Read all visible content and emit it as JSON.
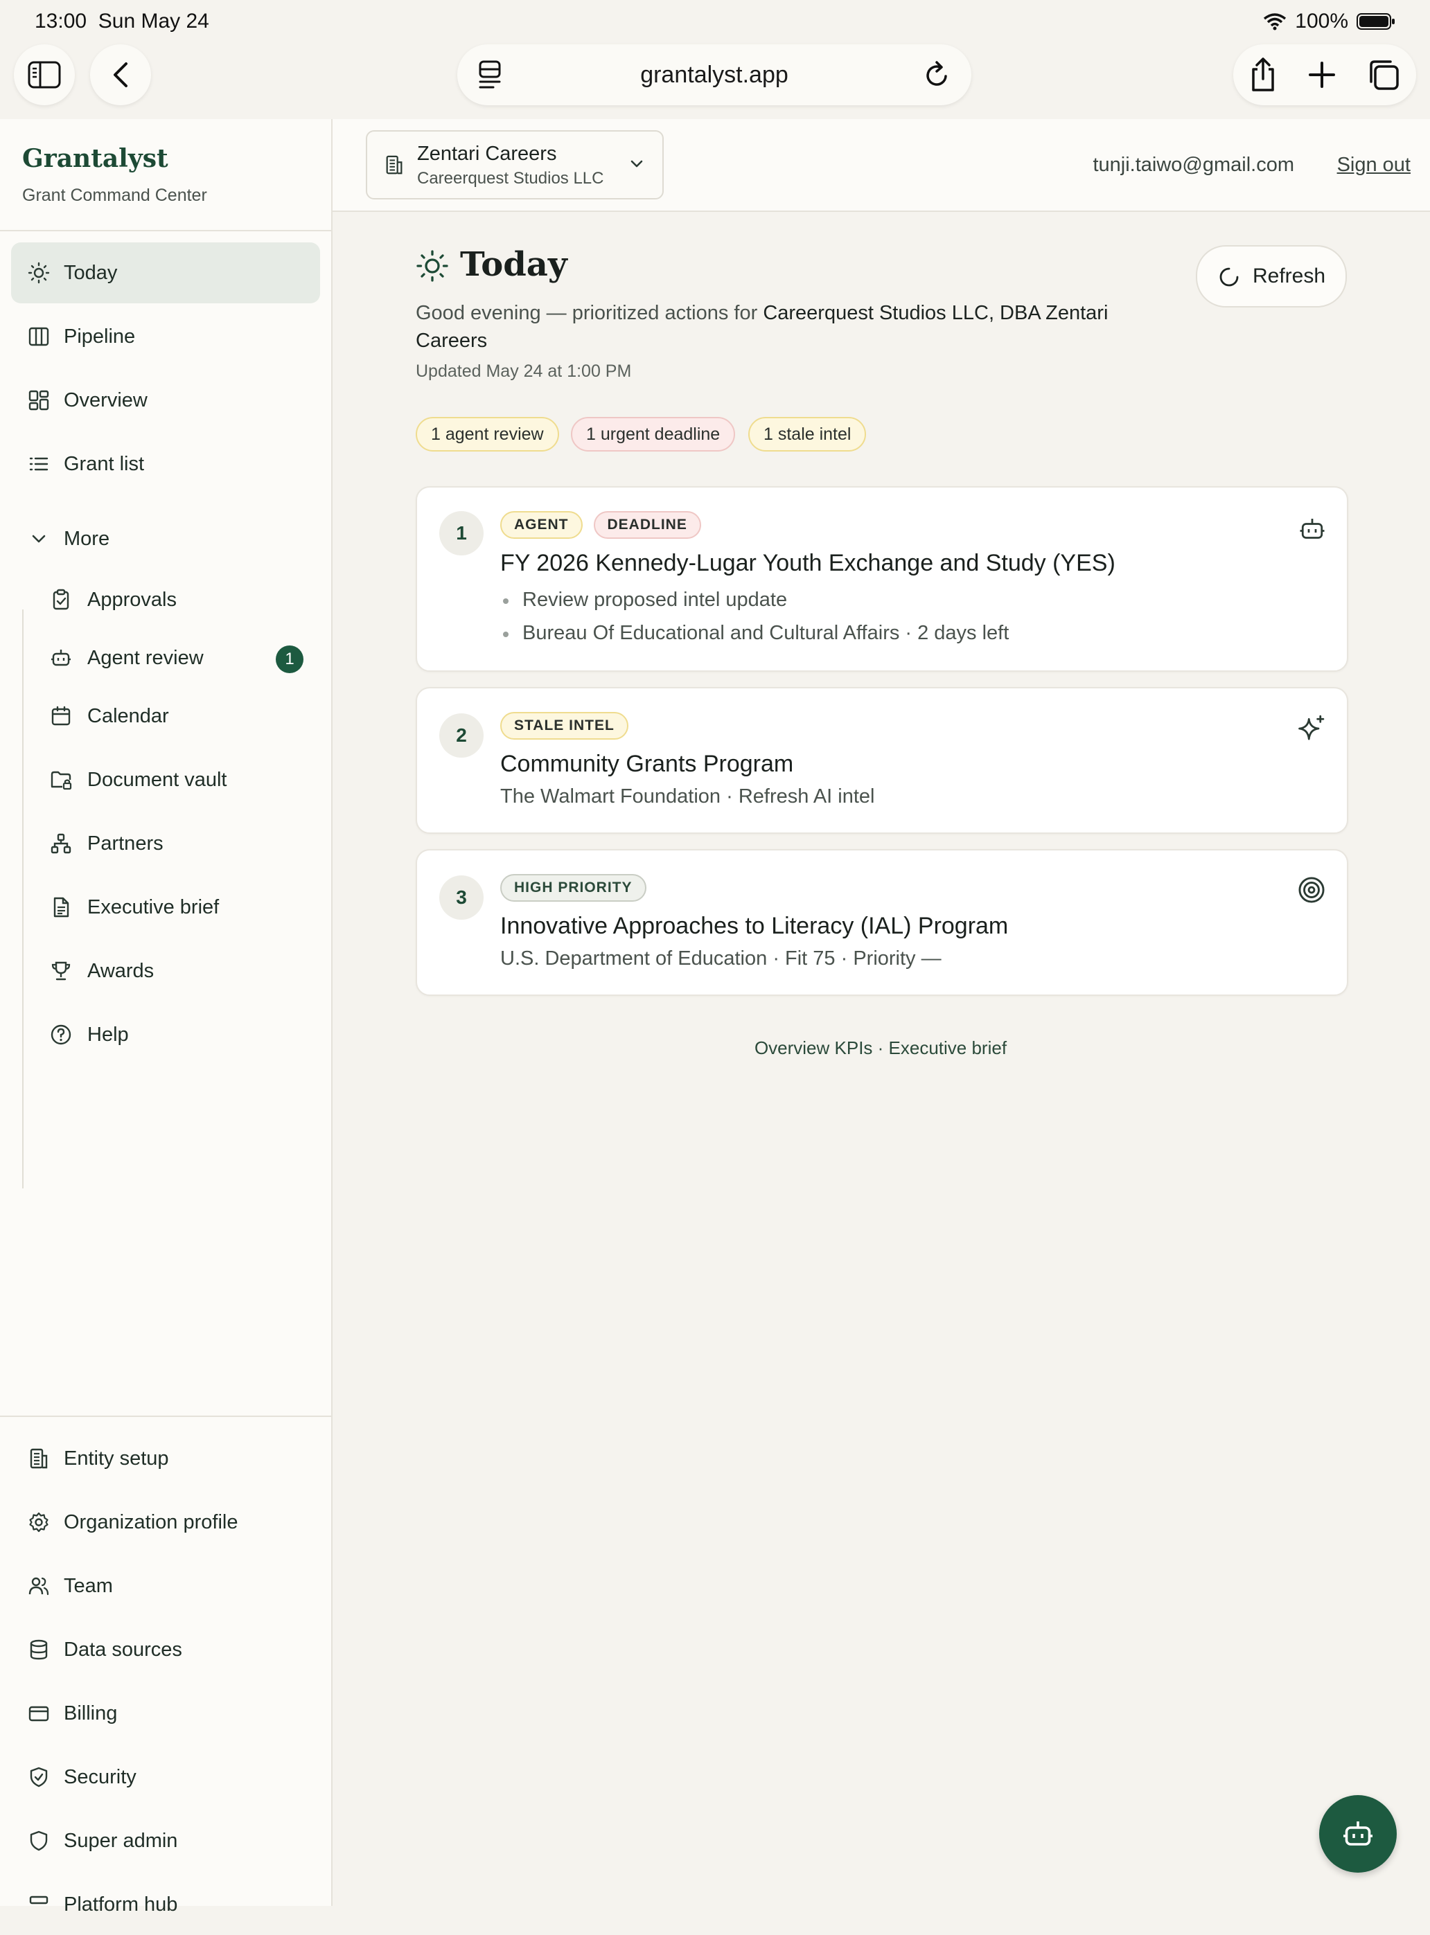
{
  "status": {
    "time": "13:00",
    "date": "Sun May 24",
    "battery": "100%"
  },
  "browser": {
    "url": "grantalyst.app"
  },
  "brand": {
    "name": "Grantalyst",
    "subtitle": "Grant Command Center"
  },
  "nav": {
    "primary": [
      "Today",
      "Pipeline",
      "Overview",
      "Grant list"
    ],
    "more_label": "More",
    "more": [
      {
        "label": "Approvals",
        "icon": "clipboard-check-icon"
      },
      {
        "label": "Agent review",
        "icon": "bot-icon",
        "badge": "1"
      },
      {
        "label": "Calendar",
        "icon": "calendar-icon"
      },
      {
        "label": "Document vault",
        "icon": "folder-lock-icon"
      },
      {
        "label": "Partners",
        "icon": "network-icon"
      },
      {
        "label": "Executive brief",
        "icon": "document-icon"
      },
      {
        "label": "Awards",
        "icon": "trophy-icon"
      },
      {
        "label": "Help",
        "icon": "help-circle-icon"
      }
    ],
    "settings": [
      "Entity setup",
      "Organization profile",
      "Team",
      "Data sources",
      "Billing",
      "Security",
      "Super admin",
      "Platform hub"
    ]
  },
  "org": {
    "name": "Zentari Careers",
    "legal": "Careerquest Studios LLC"
  },
  "user": {
    "email": "tunji.taiwo@gmail.com",
    "sign_out": "Sign out"
  },
  "page": {
    "title": "Today",
    "refresh": "Refresh",
    "greeting_prefix": "Good evening — prioritized actions for ",
    "greeting_org": "Careerquest Studios LLC, DBA Zentari Careers",
    "updated": "Updated May 24 at 1:00 PM",
    "chips": [
      "1 agent review",
      "1 urgent deadline",
      "1 stale intel"
    ]
  },
  "cards": [
    {
      "num": "1",
      "tags": [
        "AGENT",
        "DEADLINE"
      ],
      "title": "FY 2026 Kennedy-Lugar Youth Exchange and Study (YES)",
      "bullets": [
        "Review proposed intel update",
        "Bureau Of Educational and Cultural Affairs · 2 days left"
      ]
    },
    {
      "num": "2",
      "tags": [
        "STALE INTEL"
      ],
      "title": "Community Grants Program",
      "subtitle": "The Walmart Foundation · Refresh AI intel"
    },
    {
      "num": "3",
      "tags": [
        "HIGH PRIORITY"
      ],
      "title": "Innovative Approaches to Literacy (IAL) Program",
      "subtitle": "U.S. Department of Education · Fit 75 · Priority —"
    }
  ],
  "footer": {
    "links": "Overview KPIs · Executive brief"
  },
  "colors": {
    "accent": "#1d5a40",
    "background": "#f5f3ee",
    "sidebar": "#fcfbf8"
  }
}
